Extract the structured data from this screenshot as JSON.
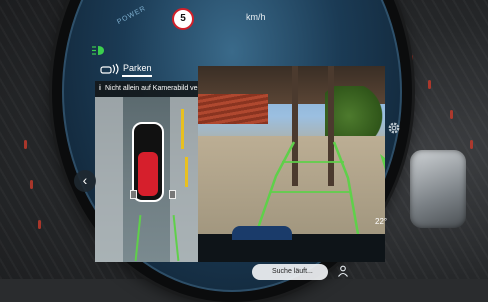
{
  "status": {
    "power_label": "POWER",
    "speed_limit": "5",
    "speed_unit": "km/h",
    "temperature": "22°"
  },
  "parking": {
    "tab_label": "Parken",
    "warning_text": "Nicht allein auf Kamerabild verlassen."
  },
  "search": {
    "text": "Suche läuft..."
  },
  "colors": {
    "guide_green": "#5fd04a",
    "warning_yellow": "#e8c020",
    "car_red": "#d61f2c",
    "speed_sign_ring": "#d0202a"
  },
  "icons": {
    "light": "headlight-icon",
    "parking": "parking-assist-icon",
    "info": "info-icon",
    "back": "chevron-left-icon",
    "settings": "gear-icon",
    "person": "person-icon"
  }
}
